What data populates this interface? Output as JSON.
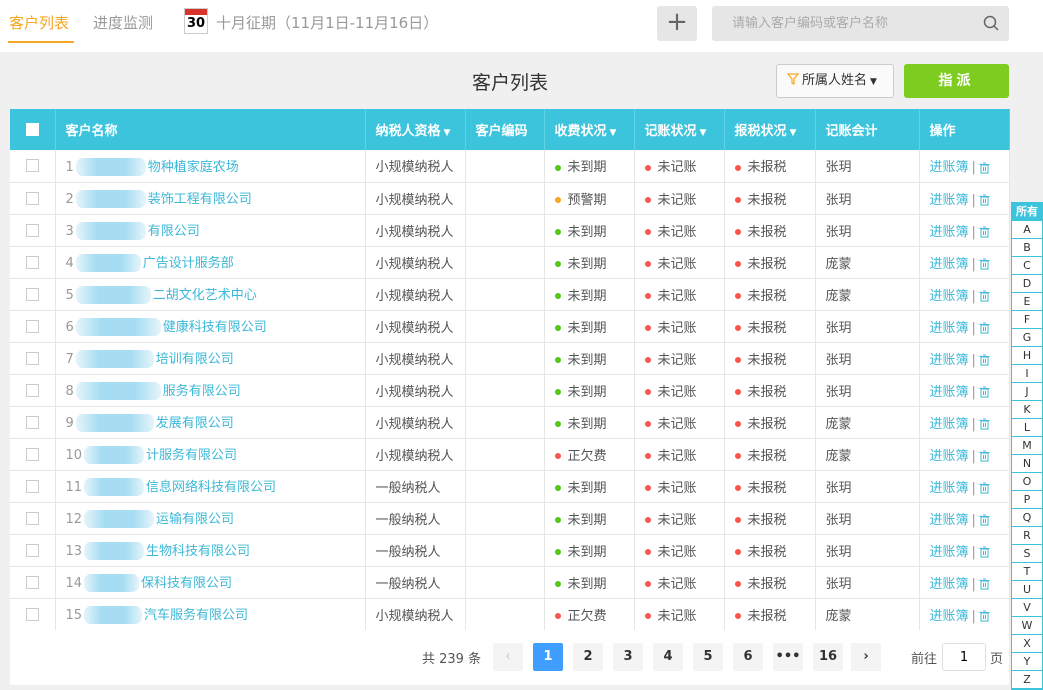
{
  "tabs": [
    {
      "label": "客户列表",
      "active": true
    },
    {
      "label": "进度监测",
      "active": false
    }
  ],
  "calendar_day": "30",
  "period_label": "十月征期（11月1日-11月16日）",
  "add_symbol": "+",
  "search": {
    "placeholder": "请输入客户编码或客户名称"
  },
  "page_title": "客户列表",
  "filter_label": "所属人姓名",
  "assign_label": "指派",
  "columns": [
    "客户名称",
    "纳税人资格",
    "客户编码",
    "收费状况",
    "记账状况",
    "报税状况",
    "记账会计",
    "操作"
  ],
  "sortable_columns": [
    false,
    true,
    false,
    true,
    true,
    true,
    false,
    false
  ],
  "status_colors": {
    "未到期": "#52c41a",
    "预警期": "#f5a623",
    "正欠费": "#f5584f",
    "未记账": "#f5584f",
    "未报税": "#f5584f"
  },
  "rows": [
    {
      "idx": "1",
      "name": "物种植家庭农场",
      "taxpayer": "小规模纳税人",
      "code": "",
      "fee": "未到期",
      "book": "未记账",
      "tax": "未报税",
      "accountant": "张玥"
    },
    {
      "idx": "2",
      "name": "装饰工程有限公司",
      "taxpayer": "小规模纳税人",
      "code": "",
      "fee": "预警期",
      "book": "未记账",
      "tax": "未报税",
      "accountant": "张玥"
    },
    {
      "idx": "3",
      "name": "有限公司",
      "taxpayer": "小规模纳税人",
      "code": "",
      "fee": "未到期",
      "book": "未记账",
      "tax": "未报税",
      "accountant": "张玥"
    },
    {
      "idx": "4",
      "name": "广告设计服务部",
      "taxpayer": "小规模纳税人",
      "code": "",
      "fee": "未到期",
      "book": "未记账",
      "tax": "未报税",
      "accountant": "庞蒙"
    },
    {
      "idx": "5",
      "name": "二胡文化艺术中心",
      "taxpayer": "小规模纳税人",
      "code": "",
      "fee": "未到期",
      "book": "未记账",
      "tax": "未报税",
      "accountant": "庞蒙"
    },
    {
      "idx": "6",
      "name": "健康科技有限公司",
      "taxpayer": "小规模纳税人",
      "code": "",
      "fee": "未到期",
      "book": "未记账",
      "tax": "未报税",
      "accountant": "张玥"
    },
    {
      "idx": "7",
      "name": "培训有限公司",
      "taxpayer": "小规模纳税人",
      "code": "",
      "fee": "未到期",
      "book": "未记账",
      "tax": "未报税",
      "accountant": "张玥"
    },
    {
      "idx": "8",
      "name": "服务有限公司",
      "taxpayer": "小规模纳税人",
      "code": "",
      "fee": "未到期",
      "book": "未记账",
      "tax": "未报税",
      "accountant": "张玥"
    },
    {
      "idx": "9",
      "name": "发展有限公司",
      "taxpayer": "小规模纳税人",
      "code": "",
      "fee": "未到期",
      "book": "未记账",
      "tax": "未报税",
      "accountant": "庞蒙"
    },
    {
      "idx": "10",
      "name": "计服务有限公司",
      "taxpayer": "小规模纳税人",
      "code": "",
      "fee": "正欠费",
      "book": "未记账",
      "tax": "未报税",
      "accountant": "庞蒙"
    },
    {
      "idx": "11",
      "name": "信息网络科技有限公司",
      "taxpayer": "一般纳税人",
      "code": "",
      "fee": "未到期",
      "book": "未记账",
      "tax": "未报税",
      "accountant": "张玥"
    },
    {
      "idx": "12",
      "name": "运输有限公司",
      "taxpayer": "一般纳税人",
      "code": "",
      "fee": "未到期",
      "book": "未记账",
      "tax": "未报税",
      "accountant": "张玥"
    },
    {
      "idx": "13",
      "name": "生物科技有限公司",
      "taxpayer": "一般纳税人",
      "code": "",
      "fee": "未到期",
      "book": "未记账",
      "tax": "未报税",
      "accountant": "张玥"
    },
    {
      "idx": "14",
      "name": "保科技有限公司",
      "taxpayer": "一般纳税人",
      "code": "",
      "fee": "未到期",
      "book": "未记账",
      "tax": "未报税",
      "accountant": "张玥"
    },
    {
      "idx": "15",
      "name": "汽车服务有限公司",
      "taxpayer": "小规模纳税人",
      "code": "",
      "fee": "正欠费",
      "book": "未记账",
      "tax": "未报税",
      "accountant": "庞蒙"
    }
  ],
  "row_action": "进账簿",
  "alphabet": [
    "所有",
    "A",
    "B",
    "C",
    "D",
    "E",
    "F",
    "G",
    "H",
    "I",
    "J",
    "K",
    "L",
    "M",
    "N",
    "O",
    "P",
    "Q",
    "R",
    "S",
    "T",
    "U",
    "V",
    "W",
    "X",
    "Y",
    "Z"
  ],
  "pagination": {
    "total_text": "共 239 条",
    "pages": [
      "1",
      "2",
      "3",
      "4",
      "5",
      "6",
      "•••",
      "16"
    ],
    "current": "1",
    "goto_label": "前往",
    "goto_value": "1",
    "page_unit": "页"
  }
}
